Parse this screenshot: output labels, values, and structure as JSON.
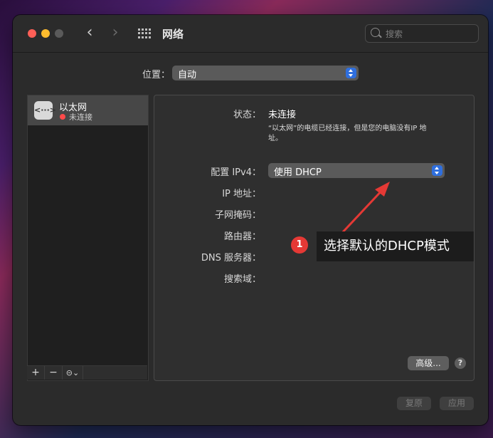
{
  "window": {
    "title": "网络",
    "search_placeholder": "搜索"
  },
  "location": {
    "label": "位置：",
    "value": "自动"
  },
  "sidebar": {
    "services": [
      {
        "name": "以太网",
        "status": "未连接",
        "status_color": "#ff4a4a"
      }
    ],
    "toolbar": {
      "add": "+",
      "remove": "−",
      "action": "⊝⌄"
    }
  },
  "detail": {
    "status_label": "状态：",
    "status_value": "未连接",
    "status_desc": "“以太网”的电缆已经连接，但是您的电脑没有IP 地址。",
    "configure_label": "配置 IPv4：",
    "configure_value": "使用 DHCP",
    "ip_label": "IP 地址：",
    "subnet_label": "子网掩码：",
    "router_label": "路由器：",
    "dns_label": "DNS 服务器：",
    "search_domain_label": "搜索域：",
    "advanced_label": "高级...",
    "help_label": "?"
  },
  "footer": {
    "revert_label": "复原",
    "apply_label": "应用"
  },
  "annotation": {
    "number": "1",
    "text": "选择默认的DHCP模式"
  },
  "colors": {
    "accent": "#2f6fde",
    "annotation_red": "#e53935"
  }
}
